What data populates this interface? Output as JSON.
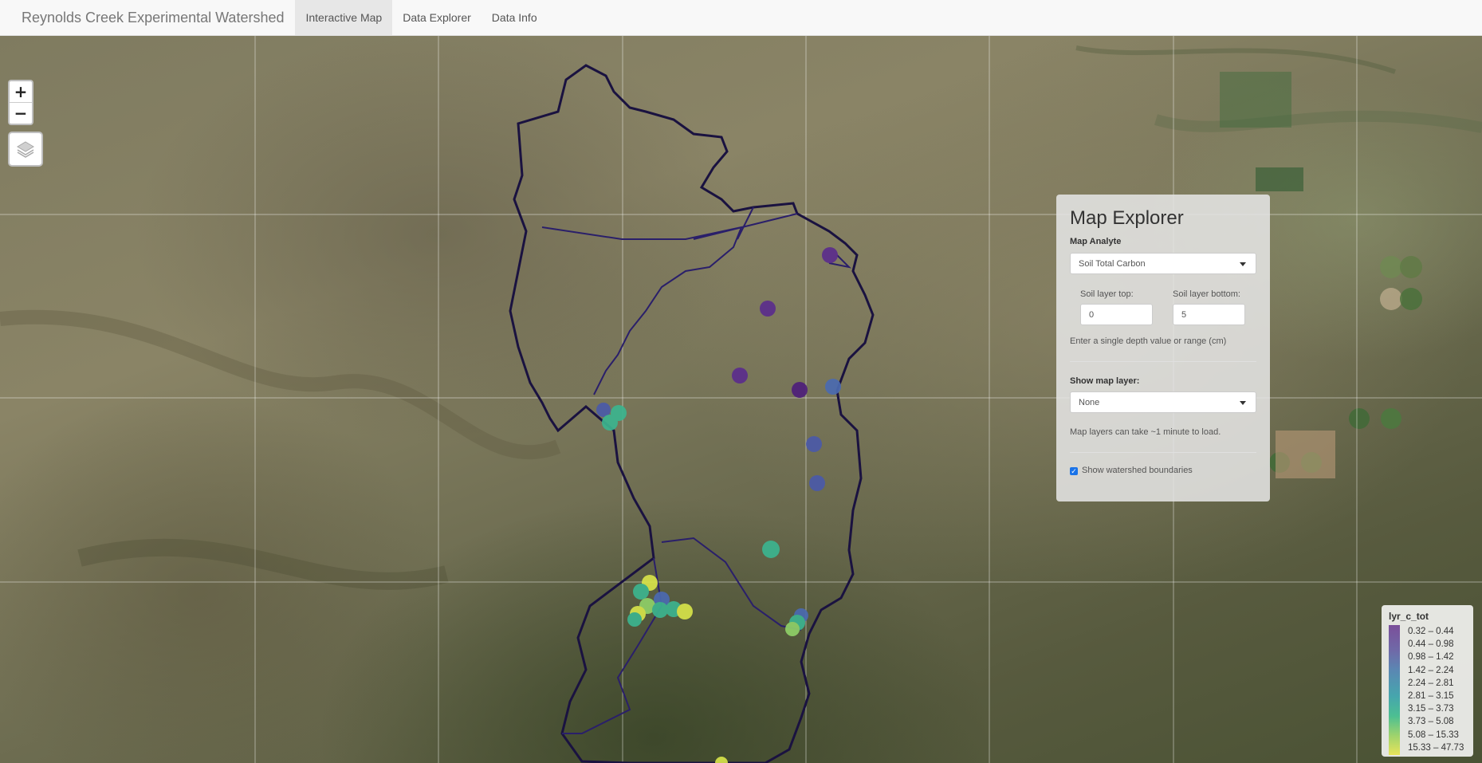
{
  "navbar": {
    "brand": "Reynolds Creek Experimental Watershed",
    "tabs": [
      "Interactive Map",
      "Data Explorer",
      "Data Info"
    ],
    "active_tab": "Interactive Map"
  },
  "map_controls": {
    "zoom_in": "+",
    "zoom_out": "−"
  },
  "panel": {
    "title": "Map Explorer",
    "analyte_label": "Map Analyte",
    "analyte_value": "Soil Total Carbon",
    "top_label": "Soil layer top:",
    "top_value": "0",
    "bottom_label": "Soil layer bottom:",
    "bottom_value": "5",
    "depth_help": "Enter a single depth value or range (cm)",
    "layer_label": "Show map layer:",
    "layer_value": "None",
    "layer_help": "Map layers can take ~1 minute to load.",
    "boundaries_label": "Show watershed boundaries",
    "boundaries_checked": true
  },
  "legend": {
    "title": "lyr_c_tot",
    "items": [
      "0.32 – 0.44",
      "0.44 – 0.98",
      "0.98 – 1.42",
      "1.42 – 2.24",
      "2.24 – 2.81",
      "2.81 – 3.15",
      "3.15 – 3.73",
      "3.73 – 5.08",
      "5.08 – 15.33",
      "15.33 – 47.73"
    ]
  },
  "colors": {
    "boundary": "#1a1240",
    "purple": "#5b2d8c",
    "indigo": "#4b5aa8",
    "teal": "#3cb48f",
    "green": "#8fd068",
    "yellow": "#d7e34a"
  }
}
